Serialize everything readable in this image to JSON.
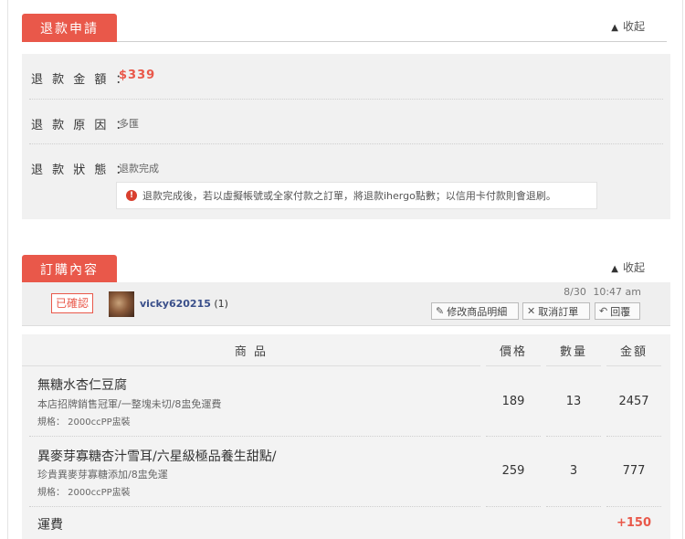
{
  "refund": {
    "tab": "退款申請",
    "collapse": "收起",
    "amount_label": "退 款 金 額 ：",
    "amount_value": "$339",
    "reason_label": "退 款 原 因 ：",
    "reason_value": "多匯",
    "status_label": "退 款 狀 態 ：",
    "status_value": "退款完成",
    "notice": "退款完成後，若以虛擬帳號或全家付款之訂單，將退款ihergo點數；以信用卡付款則會退刷。"
  },
  "order": {
    "tab": "訂購內容",
    "collapse": "收起",
    "badge": "已確認",
    "username": "vicky620215",
    "user_count": "(1)",
    "date": "8/30",
    "time": "10:47 am",
    "btn_edit": "修改商品明細",
    "btn_cancel": "取消訂單",
    "btn_reply": "回覆",
    "columns": [
      "商 品",
      "價格",
      "數量",
      "金額"
    ],
    "items": [
      {
        "name": "無糖水杏仁豆腐",
        "sub": "本店招牌銷售冠軍/一整塊未切/8盅免運費",
        "spec": "規格： 2000ccPP盅裝",
        "price": "189",
        "qty": "13",
        "total": "2457"
      },
      {
        "name": "異麥芽寡糖杏汁雪耳/六星級極品養生甜點/",
        "sub": "珍貴異麥芽寡糖添加/8盅免運",
        "spec": "規格： 2000ccPP盅裝",
        "price": "259",
        "qty": "3",
        "total": "777"
      }
    ],
    "shipping_label": "運費",
    "shipping_value": "+150"
  },
  "colors": {
    "accent": "#e9584a",
    "panel": "#f1f1f1"
  }
}
